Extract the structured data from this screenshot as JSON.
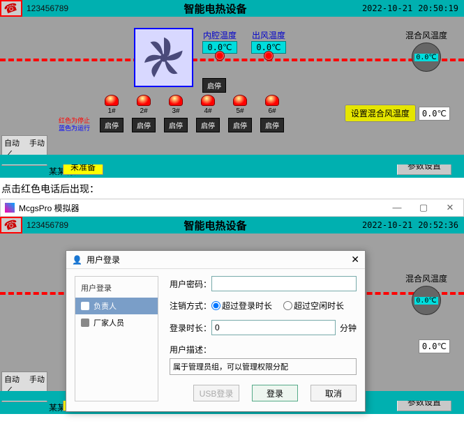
{
  "header": {
    "phone": "123456789",
    "title": "智能电热设备",
    "date": "2022-10-21",
    "time1": "20:50:19",
    "time2": "20:52:36"
  },
  "temps": {
    "cavity_label": "内腔温度",
    "cavity_val": "0.0℃",
    "outlet_label": "出风温度",
    "outlet_val": "0.0℃",
    "mix_label": "混合风温度",
    "mix_val": "0.0℃"
  },
  "fan": {
    "stop_label": "启停"
  },
  "heaters": {
    "note_line1": "红色为停止",
    "note_line2": "蓝色为运行",
    "items": [
      {
        "label": "1#",
        "btn": "启停"
      },
      {
        "label": "2#",
        "btn": "启停"
      },
      {
        "label": "3#",
        "btn": "启停"
      },
      {
        "label": "4#",
        "btn": "启停"
      },
      {
        "label": "5#",
        "btn": "启停"
      },
      {
        "label": "6#",
        "btn": "启停"
      }
    ]
  },
  "set_temp": {
    "label": "设置混合风温度",
    "val": "0.0℃"
  },
  "mode": {
    "auto": "自动",
    "manual": "手动"
  },
  "status": "未准备",
  "param_btn": "参数设置",
  "company": "某某有限公司",
  "instruction": "点击红色电话后出现：",
  "simulator": {
    "title": "McgsPro 模拟器"
  },
  "dialog": {
    "title": "用户登录",
    "left_header": "用户登录",
    "users": [
      {
        "name": "负责人",
        "selected": true
      },
      {
        "name": "厂家人员",
        "selected": false
      }
    ],
    "pwd_label": "用户密码：",
    "logout_label": "注销方式：",
    "radio1": "超过登录时长",
    "radio2": "超过空闲时长",
    "duration_label": "登录时长：",
    "duration_val": "0",
    "duration_unit": "分钟",
    "desc_label": "用户描述：",
    "desc_val": "属于管理员组，可以管理权限分配",
    "btn_usb": "USB登录",
    "btn_login": "登录",
    "btn_cancel": "取消"
  }
}
